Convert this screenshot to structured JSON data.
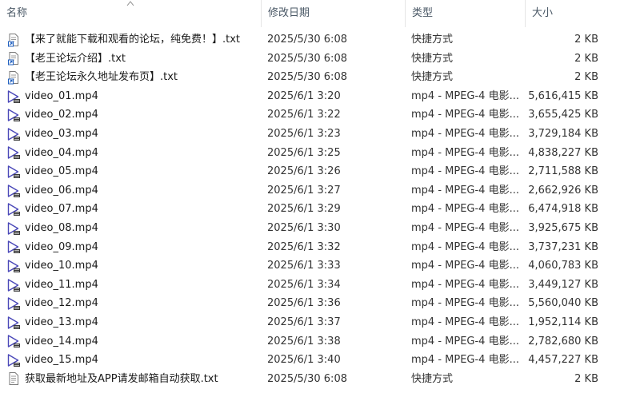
{
  "columns": {
    "name": "名称",
    "date": "修改日期",
    "type": "类型",
    "size": "大小"
  },
  "files": [
    {
      "icon": "shortcut-file-icon",
      "name": "【来了就能下载和观看的论坛，纯免费！】.txt",
      "date": "2025/5/30 6:08",
      "type": "快捷方式",
      "size": "2 KB"
    },
    {
      "icon": "shortcut-file-icon",
      "name": "【老王论坛介绍】.txt",
      "date": "2025/5/30 6:08",
      "type": "快捷方式",
      "size": "2 KB"
    },
    {
      "icon": "shortcut-file-icon",
      "name": "【老王论坛永久地址发布页】.txt",
      "date": "2025/5/30 6:08",
      "type": "快捷方式",
      "size": "2 KB"
    },
    {
      "icon": "video-file-icon",
      "name": "video_01.mp4",
      "date": "2025/6/1 3:20",
      "type": "mp4 - MPEG-4 电影...",
      "size": "5,616,415 KB"
    },
    {
      "icon": "video-file-icon",
      "name": "video_02.mp4",
      "date": "2025/6/1 3:22",
      "type": "mp4 - MPEG-4 电影...",
      "size": "3,655,425 KB"
    },
    {
      "icon": "video-file-icon",
      "name": "video_03.mp4",
      "date": "2025/6/1 3:23",
      "type": "mp4 - MPEG-4 电影...",
      "size": "3,729,184 KB"
    },
    {
      "icon": "video-file-icon",
      "name": "video_04.mp4",
      "date": "2025/6/1 3:25",
      "type": "mp4 - MPEG-4 电影...",
      "size": "4,838,227 KB"
    },
    {
      "icon": "video-file-icon",
      "name": "video_05.mp4",
      "date": "2025/6/1 3:26",
      "type": "mp4 - MPEG-4 电影...",
      "size": "2,711,588 KB"
    },
    {
      "icon": "video-file-icon",
      "name": "video_06.mp4",
      "date": "2025/6/1 3:27",
      "type": "mp4 - MPEG-4 电影...",
      "size": "2,662,926 KB"
    },
    {
      "icon": "video-file-icon",
      "name": "video_07.mp4",
      "date": "2025/6/1 3:29",
      "type": "mp4 - MPEG-4 电影...",
      "size": "6,474,918 KB"
    },
    {
      "icon": "video-file-icon",
      "name": "video_08.mp4",
      "date": "2025/6/1 3:30",
      "type": "mp4 - MPEG-4 电影...",
      "size": "3,925,675 KB"
    },
    {
      "icon": "video-file-icon",
      "name": "video_09.mp4",
      "date": "2025/6/1 3:32",
      "type": "mp4 - MPEG-4 电影...",
      "size": "3,737,231 KB"
    },
    {
      "icon": "video-file-icon",
      "name": "video_10.mp4",
      "date": "2025/6/1 3:33",
      "type": "mp4 - MPEG-4 电影...",
      "size": "4,060,783 KB"
    },
    {
      "icon": "video-file-icon",
      "name": "video_11.mp4",
      "date": "2025/6/1 3:34",
      "type": "mp4 - MPEG-4 电影...",
      "size": "3,449,127 KB"
    },
    {
      "icon": "video-file-icon",
      "name": "video_12.mp4",
      "date": "2025/6/1 3:36",
      "type": "mp4 - MPEG-4 电影...",
      "size": "5,560,040 KB"
    },
    {
      "icon": "video-file-icon",
      "name": "video_13.mp4",
      "date": "2025/6/1 3:37",
      "type": "mp4 - MPEG-4 电影...",
      "size": "1,952,114 KB"
    },
    {
      "icon": "video-file-icon",
      "name": "video_14.mp4",
      "date": "2025/6/1 3:38",
      "type": "mp4 - MPEG-4 电影...",
      "size": "2,782,680 KB"
    },
    {
      "icon": "video-file-icon",
      "name": "video_15.mp4",
      "date": "2025/6/1 3:40",
      "type": "mp4 - MPEG-4 电影...",
      "size": "4,457,227 KB"
    },
    {
      "icon": "text-file-icon",
      "name": "获取最新地址及APP请发邮箱自动获取.txt",
      "date": "2025/5/30 6:08",
      "type": "快捷方式",
      "size": "2 KB"
    }
  ]
}
